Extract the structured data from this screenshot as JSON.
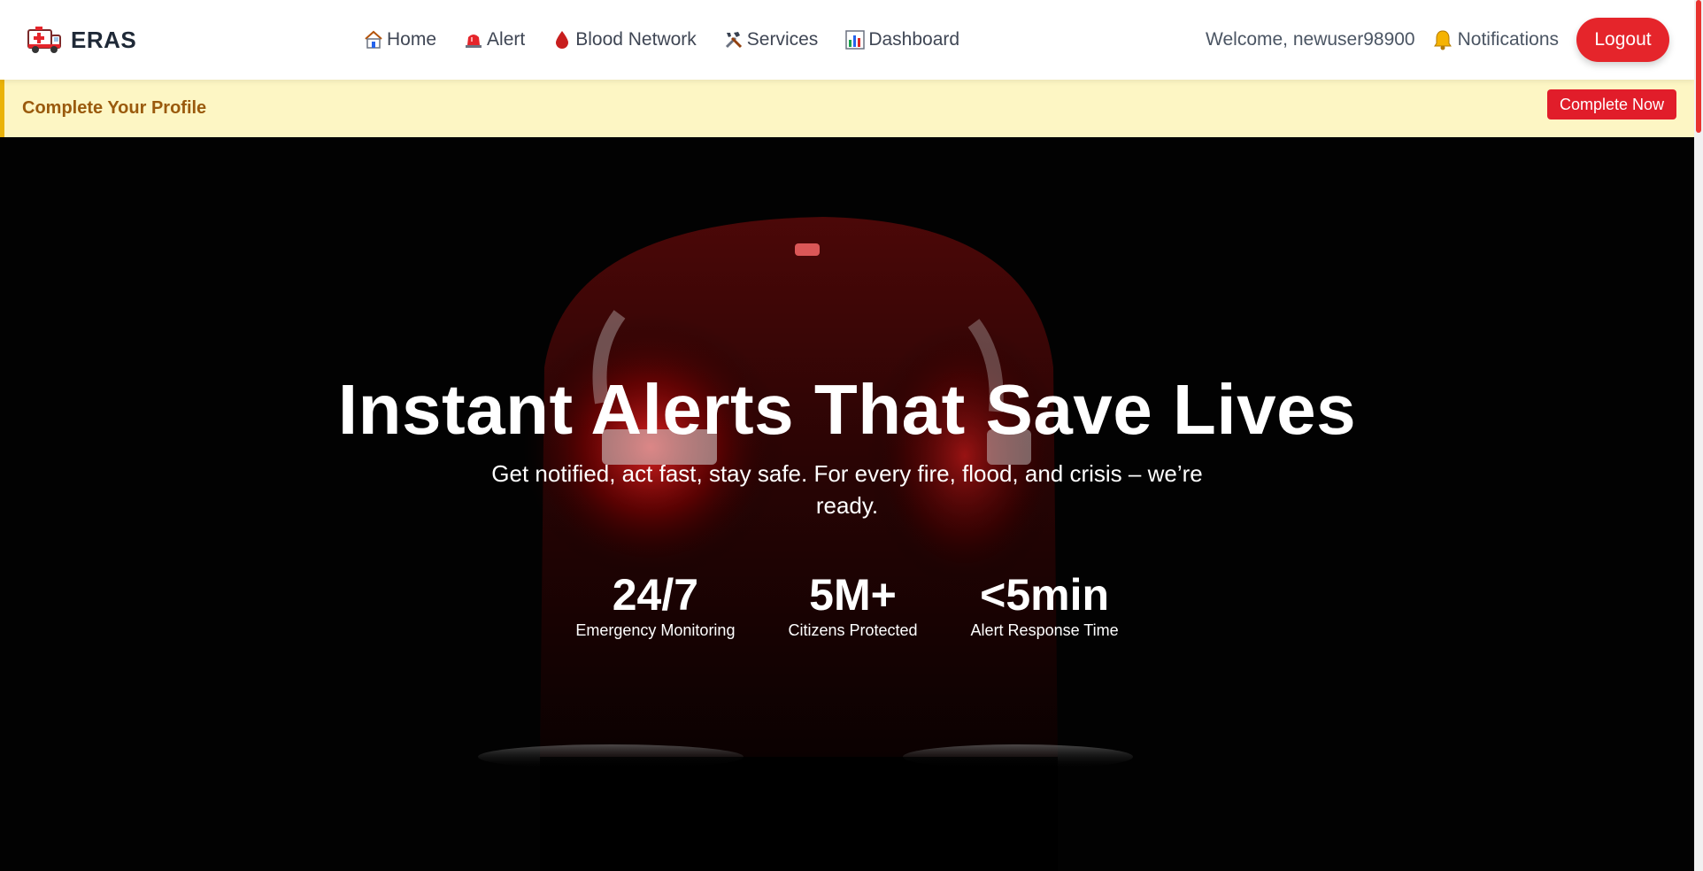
{
  "brand": {
    "name": "ERAS",
    "logo_icon": "ambulance-icon"
  },
  "nav": {
    "links": [
      {
        "label": "Home",
        "icon": "house-icon"
      },
      {
        "label": "Alert",
        "icon": "siren-icon"
      },
      {
        "label": "Blood Network",
        "icon": "blood-drop-icon"
      },
      {
        "label": "Services",
        "icon": "tools-icon"
      },
      {
        "label": "Dashboard",
        "icon": "bar-chart-icon"
      }
    ],
    "welcome": "Welcome, newuser98900",
    "notifications_label": "Notifications",
    "logout_label": "Logout"
  },
  "profile_banner": {
    "text": "Complete Your Profile",
    "button_label": "Complete Now"
  },
  "hero": {
    "title": "Instant Alerts That Save Lives",
    "subtitle": "Get notified, act fast, stay safe. For every fire, flood, and crisis – we’re ready.",
    "stats": [
      {
        "value": "24/7",
        "label": "Emergency Monitoring"
      },
      {
        "value": "5M+",
        "label": "Citizens Protected"
      },
      {
        "value": "<5min",
        "label": "Alert Response Time"
      }
    ]
  },
  "colors": {
    "accent": "#e5252b",
    "banner_bg": "#fdf6c4",
    "banner_border": "#eab308",
    "banner_text": "#9a5a0d"
  }
}
